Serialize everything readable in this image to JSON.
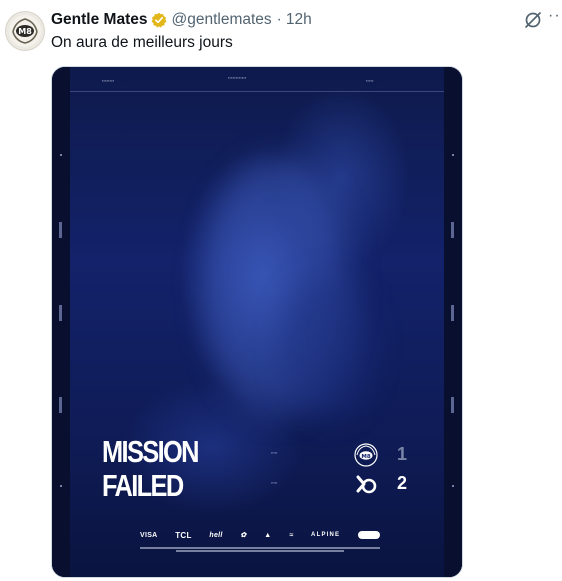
{
  "tweet": {
    "author_name": "Gentle Mates",
    "handle": "@gentlemates",
    "separator": "·",
    "time": "12h",
    "text": "On aura de meilleurs jours",
    "more": "··",
    "avatar_text": "M8"
  },
  "poster": {
    "headline_line1": "MISSION",
    "headline_line2": "FAILED",
    "team1_score": "1",
    "team2_score": "2",
    "team1_logo_text": "M8",
    "sponsors": [
      "VISA",
      "TCL",
      "hell",
      "ALPINE"
    ],
    "colors": {
      "background": "#13226a",
      "bars": "#090f2e",
      "text": "#ffffff"
    }
  },
  "icons": {
    "verified": "verified-badge-icon",
    "grok": "grok-icon",
    "more": "more-icon"
  }
}
